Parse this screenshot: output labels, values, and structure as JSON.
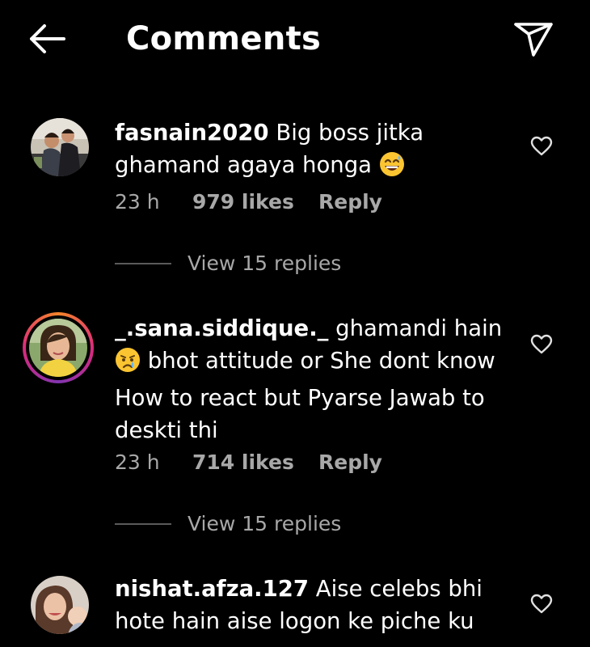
{
  "header": {
    "title": "Comments"
  },
  "comments": [
    {
      "username": "fasnain2020",
      "text": "Big boss jitka ghamand agaya honga",
      "emoji": "grinning-sweat-emoji",
      "time": "23 h",
      "likes": "979 likes",
      "reply_label": "Reply",
      "view_replies": "View 15 replies",
      "has_story_ring": false
    },
    {
      "username": "_.sana.siddique._",
      "text_part1": "ghamandi hain",
      "emoji": "crying-face-emoji",
      "text_part2": "bhot attitude or She dont know How to react but Pyarse Jawab to deskti thi",
      "time": "23 h",
      "likes": "714 likes",
      "reply_label": "Reply",
      "view_replies": "View 15 replies",
      "has_story_ring": true
    },
    {
      "username": "nishat.afza.127",
      "text": "Aise celebs bhi hote hain aise logon ke piche ku",
      "has_story_ring": false
    }
  ],
  "colors": {
    "background": "#000000",
    "text": "#ffffff",
    "secondary_text": "#a8a8a8",
    "divider": "#5a5a5a"
  }
}
